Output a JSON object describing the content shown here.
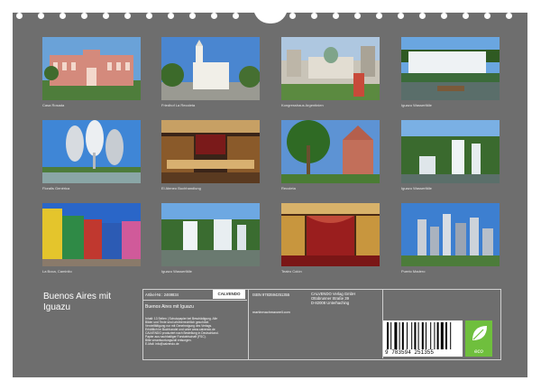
{
  "calendar": {
    "title": "Buenos Aires mit Iguazu",
    "article_label": "Artikel-Nr.: 2469834",
    "calvendo_logo": "CALVENDO",
    "isbn": "ISBN 9783594251355",
    "publisher_lines": [
      "CALVENDO Verlag GmbH",
      "Ottobrunner Straße 39",
      "D-82008 Unterhaching"
    ],
    "subtitle": "Buenos Aires mit Iguazu",
    "author_email": "martinmachmaxwell.com",
    "barcode_digits": "9 783594 251355",
    "eco_label": "eco",
    "fine_print": [
      "Inhalt: 13 Seiten | Schutzpapier bei Beschädigung. Alle",
      "Bilder und Texte sind urheberrechtlich geschützt.",
      "Vervielfältigung nur mit Genehmigung des Verlags.",
      "Erhältlich im Buchhandel und unter www.calvendo.de",
      "CALVENDO produziert nach Bestellung in Deutschland.",
      "Papier aus nachhaltiger Forstwirtschaft (FSC).",
      "Bitte verantwortungsvoll entsorgen.",
      "E-Mail: info@calvendo.de"
    ]
  },
  "photos": [
    {
      "caption": "Casa Rosada",
      "theme": "casa-rosada"
    },
    {
      "caption": "Friedhof La Recoleta",
      "theme": "recoleta-church"
    },
    {
      "caption": "Kongresshaus Argentinien",
      "theme": "congress"
    },
    {
      "caption": "Iguazu Wasserfälle",
      "theme": "iguazu-falls"
    },
    {
      "caption": "Floralis Genérica",
      "theme": "floralis"
    },
    {
      "caption": "El Ateneo Buchhandlung",
      "theme": "ateneo"
    },
    {
      "caption": "Recoleta",
      "theme": "palms"
    },
    {
      "caption": "Iguazu Wasserfälle",
      "theme": "iguazu-falls-2"
    },
    {
      "caption": "La Boca, Caminito",
      "theme": "la-boca"
    },
    {
      "caption": "Iguazu Wasserfälle",
      "theme": "iguazu-falls-3"
    },
    {
      "caption": "Teatro Colón",
      "theme": "teatro-colon"
    },
    {
      "caption": "Puerto Madero",
      "theme": "puerto-madero"
    }
  ],
  "colors": {
    "sheet": "#6e6e6e",
    "eco_badge": "#6fbf3d"
  }
}
